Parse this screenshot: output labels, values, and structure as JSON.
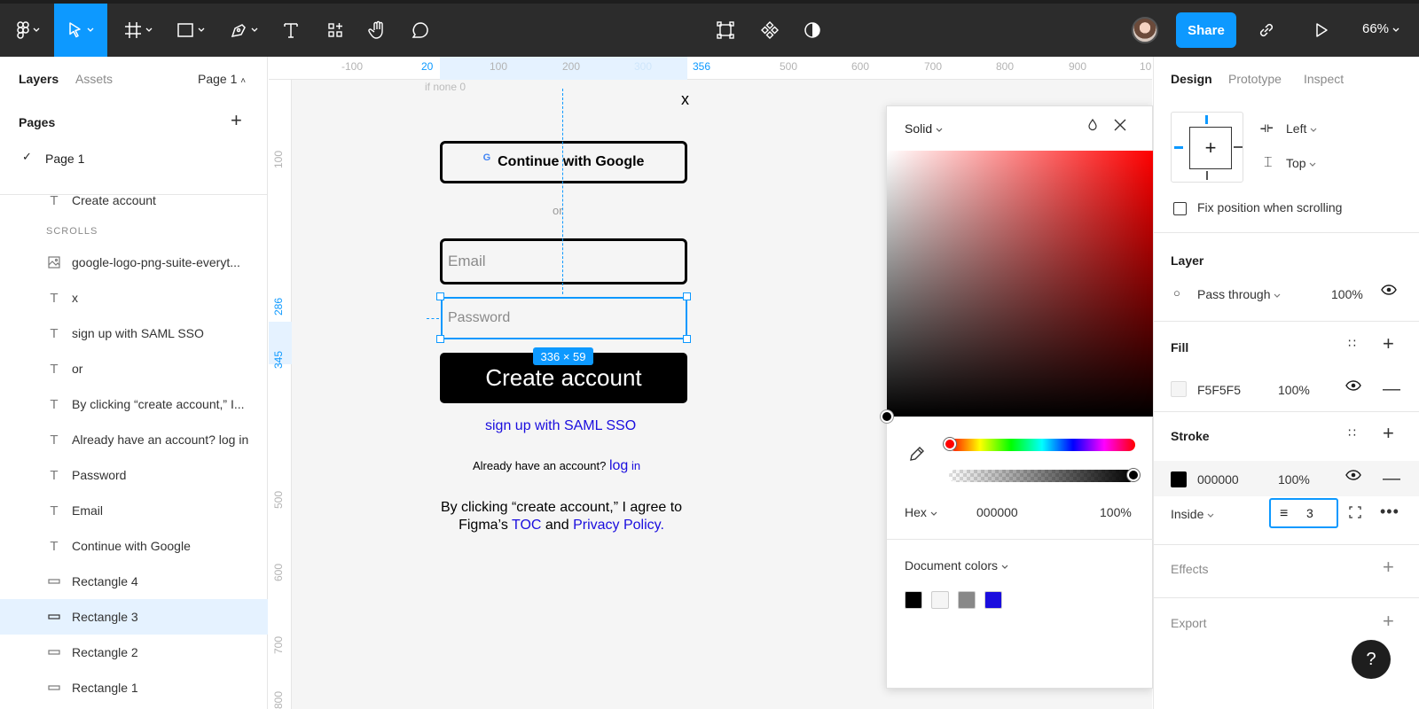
{
  "toolbar": {
    "share_label": "Share",
    "zoom": "66%"
  },
  "left_panel": {
    "tabs": [
      "Layers",
      "Assets"
    ],
    "page_select": "Page 1",
    "pages_heading": "Pages",
    "pages": [
      "Page 1"
    ],
    "section_label": "SCROLLS",
    "layers": [
      {
        "name": "Create account",
        "type": "text"
      },
      {
        "name": "google-logo-png-suite-everyt...",
        "type": "image"
      },
      {
        "name": "x",
        "type": "text"
      },
      {
        "name": "sign up with SAML SSO",
        "type": "text"
      },
      {
        "name": "or",
        "type": "text"
      },
      {
        "name": "By clicking “create account,” I...",
        "type": "text"
      },
      {
        "name": "Already have an account? log in",
        "type": "text"
      },
      {
        "name": "Password",
        "type": "text"
      },
      {
        "name": "Email",
        "type": "text"
      },
      {
        "name": "Continue with Google",
        "type": "text"
      },
      {
        "name": "Rectangle 4",
        "type": "rect"
      },
      {
        "name": "Rectangle 3",
        "type": "rect",
        "selected": true
      },
      {
        "name": "Rectangle 2",
        "type": "rect"
      },
      {
        "name": "Rectangle 1",
        "type": "rect"
      }
    ]
  },
  "canvas": {
    "ruler_top": [
      "-100",
      "20",
      "100",
      "200",
      "300",
      "356",
      "500",
      "600",
      "700",
      "800",
      "900",
      "10"
    ],
    "ruler_left": [
      "100",
      "286",
      "345",
      "500",
      "600",
      "700",
      "800"
    ],
    "top_crop": "if none 0",
    "frame_close": "x",
    "google_g": "G",
    "google_btn": "Continue with Google",
    "or": "or",
    "email_placeholder": "Email",
    "password_placeholder": "Password",
    "size_badge": "336 × 59",
    "create_btn": "Create account",
    "saml": "sign up with  SAML SSO",
    "already_prefix": "Already have an account?",
    "already_log": "log",
    "already_in": "in",
    "agree_1": "By clicking “create account,” I agree to",
    "agree_2a": "Figma’s",
    "agree_toc": "TOC",
    "agree_and": "and",
    "agree_privacy": "Privacy Policy."
  },
  "picker": {
    "fill_type": "Solid",
    "mode": "Hex",
    "hex": "000000",
    "alpha": "100%",
    "doc_colors_label": "Document colors",
    "doc_colors": [
      "#000000",
      "#f5f5f5",
      "#888888",
      "#1a0dde"
    ]
  },
  "right_panel": {
    "tabs": [
      "Design",
      "Prototype",
      "Inspect"
    ],
    "constraint_h": "Left",
    "constraint_v": "Top",
    "fix_position": "Fix position when scrolling",
    "layer_heading": "Layer",
    "blend": "Pass through",
    "opacity": "100%",
    "fill_heading": "Fill",
    "fill_hex": "F5F5F5",
    "fill_opacity": "100%",
    "stroke_heading": "Stroke",
    "stroke_hex": "000000",
    "stroke_opacity": "100%",
    "stroke_align": "Inside",
    "stroke_weight": "3",
    "effects_heading": "Effects",
    "export_heading": "Export"
  },
  "help": "?",
  "colors": {
    "accent": "#0d99ff",
    "toolbar_bg": "#2c2c2c",
    "link_blue": "#1a0dde"
  }
}
